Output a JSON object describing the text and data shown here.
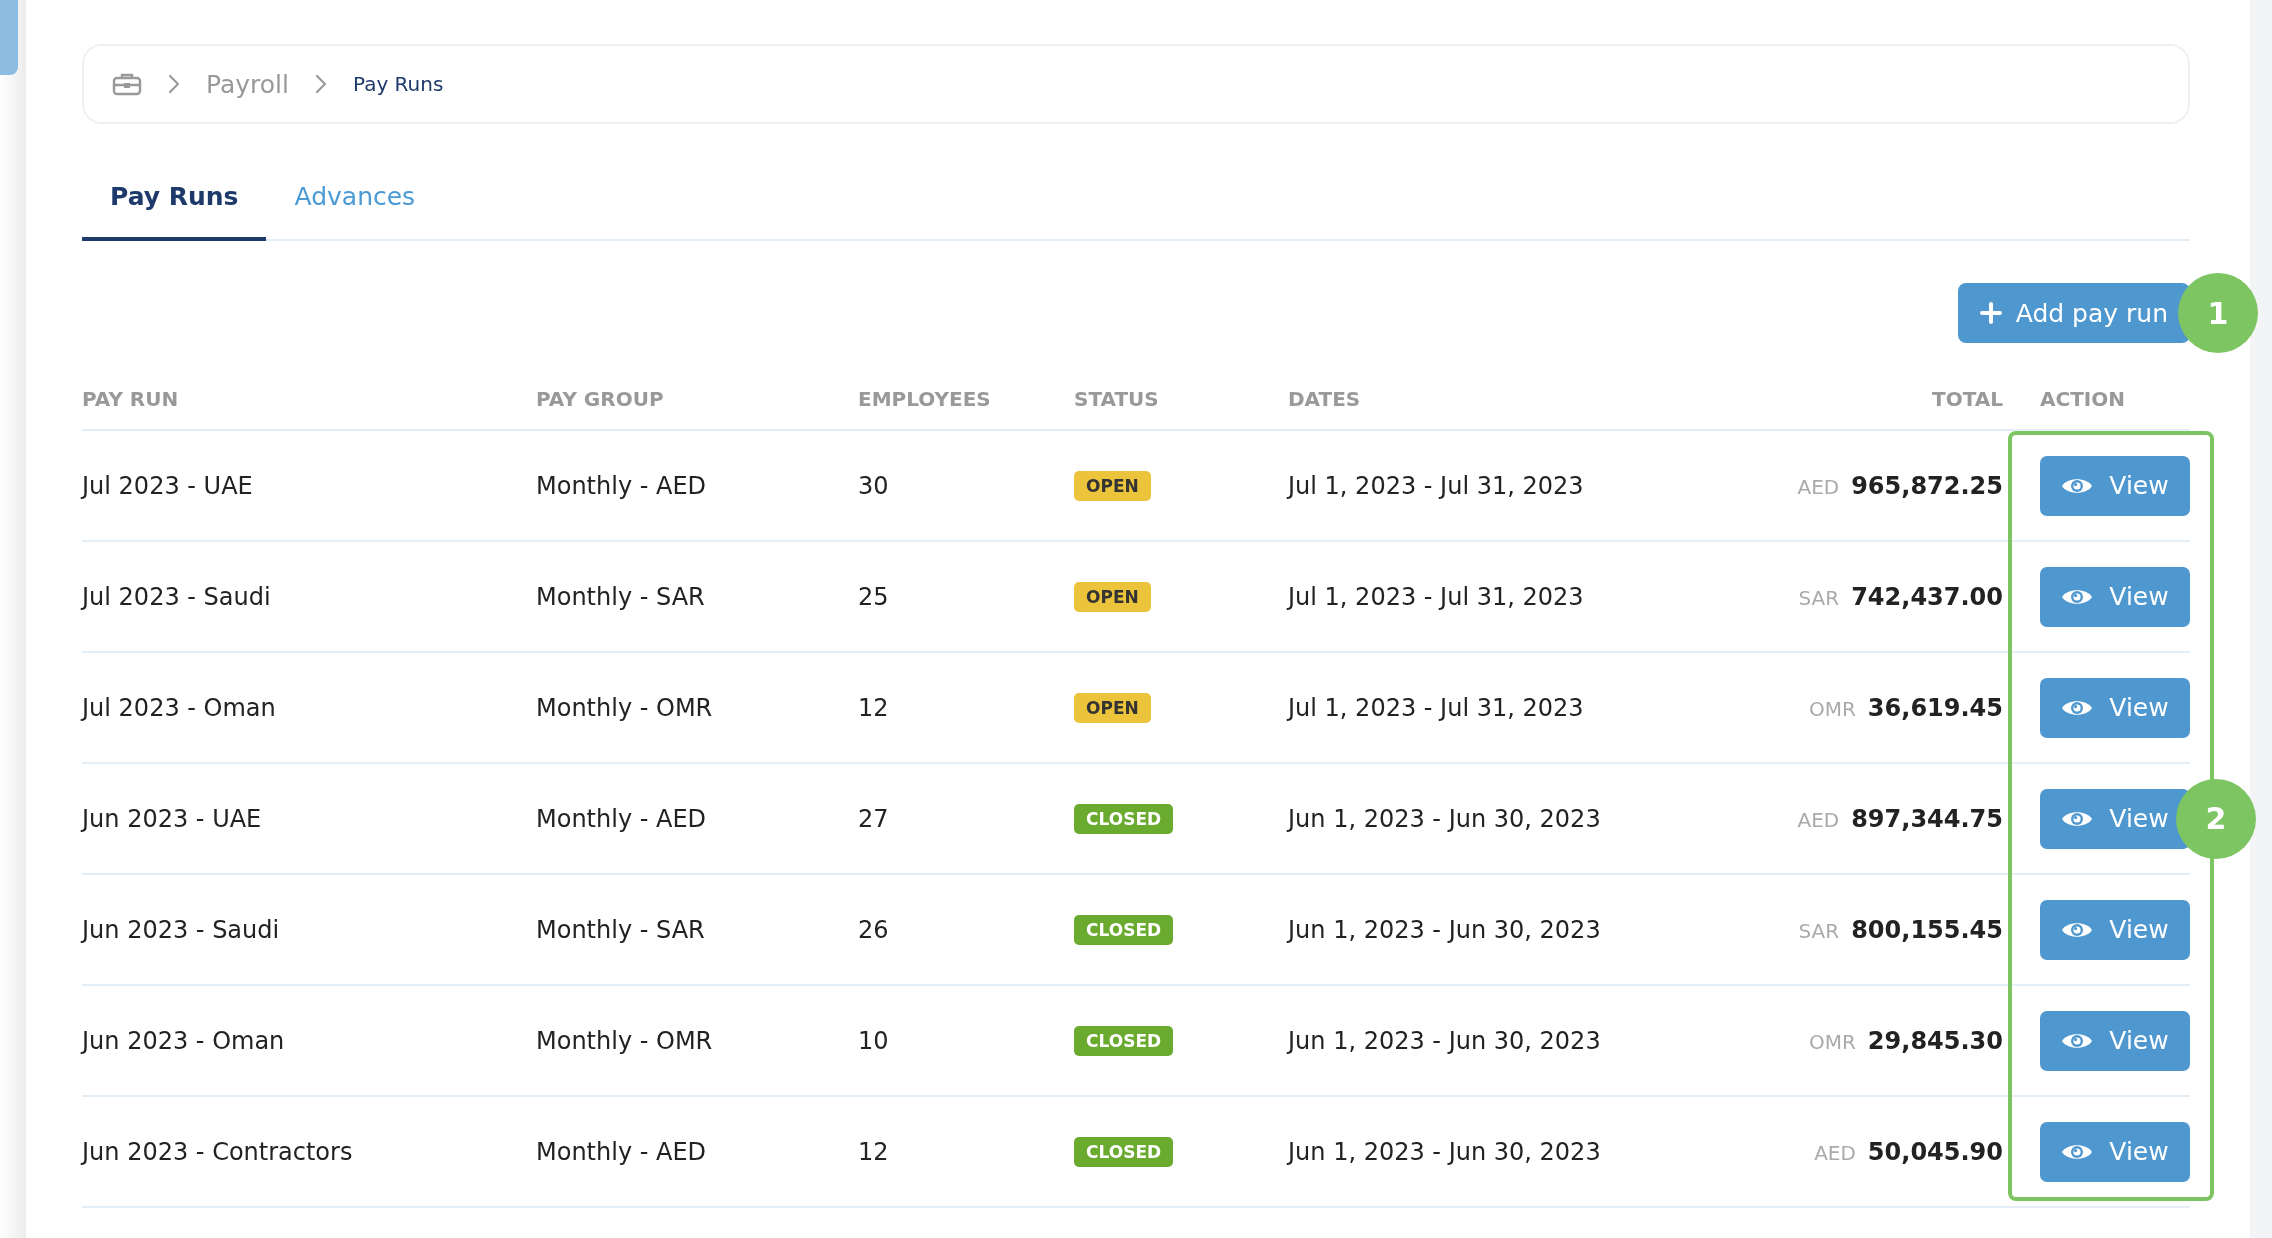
{
  "breadcrumb": {
    "items": [
      {
        "label": "Payroll",
        "current": false
      },
      {
        "label": "Pay Runs",
        "current": true
      }
    ]
  },
  "tabs": [
    {
      "label": "Pay Runs",
      "selected": true
    },
    {
      "label": "Advances",
      "selected": false
    }
  ],
  "add_button": {
    "label": "Add pay run",
    "callout": "1"
  },
  "table": {
    "columns": [
      "PAY RUN",
      "PAY GROUP",
      "EMPLOYEES",
      "STATUS",
      "DATES",
      "TOTAL",
      "ACTION"
    ],
    "highlight_action_column": true,
    "rows": [
      {
        "pay_run": "Jul 2023 - UAE",
        "pay_group": "Monthly - AED",
        "employees": "30",
        "status": {
          "label": "OPEN",
          "kind": "open"
        },
        "dates": "Jul 1, 2023 - Jul 31, 2023",
        "currency": "AED",
        "total": "965,872.25",
        "action": "View"
      },
      {
        "pay_run": "Jul 2023 - Saudi",
        "pay_group": "Monthly - SAR",
        "employees": "25",
        "status": {
          "label": "OPEN",
          "kind": "open"
        },
        "dates": "Jul 1, 2023 - Jul 31, 2023",
        "currency": "SAR",
        "total": "742,437.00",
        "action": "View"
      },
      {
        "pay_run": "Jul 2023 - Oman",
        "pay_group": "Monthly - OMR",
        "employees": "12",
        "status": {
          "label": "OPEN",
          "kind": "open"
        },
        "dates": "Jul 1, 2023 - Jul 31, 2023",
        "currency": "OMR",
        "total": "36,619.45",
        "action": "View"
      },
      {
        "pay_run": "Jun 2023 - UAE",
        "pay_group": "Monthly - AED",
        "employees": "27",
        "status": {
          "label": "CLOSED",
          "kind": "closed"
        },
        "dates": "Jun 1, 2023 - Jun 30, 2023",
        "currency": "AED",
        "total": "897,344.75",
        "action": "View",
        "callout": "2"
      },
      {
        "pay_run": "Jun 2023 - Saudi",
        "pay_group": "Monthly - SAR",
        "employees": "26",
        "status": {
          "label": "CLOSED",
          "kind": "closed"
        },
        "dates": "Jun 1, 2023 - Jun 30, 2023",
        "currency": "SAR",
        "total": "800,155.45",
        "action": "View"
      },
      {
        "pay_run": "Jun 2023 - Oman",
        "pay_group": "Monthly - OMR",
        "employees": "10",
        "status": {
          "label": "CLOSED",
          "kind": "closed"
        },
        "dates": "Jun 1, 2023 - Jun 30, 2023",
        "currency": "OMR",
        "total": "29,845.30",
        "action": "View"
      },
      {
        "pay_run": "Jun 2023 - Contractors",
        "pay_group": "Monthly - AED",
        "employees": "12",
        "status": {
          "label": "CLOSED",
          "kind": "closed"
        },
        "dates": "Jun 1, 2023 - Jun 30, 2023",
        "currency": "AED",
        "total": "50,045.90",
        "action": "View"
      }
    ]
  }
}
